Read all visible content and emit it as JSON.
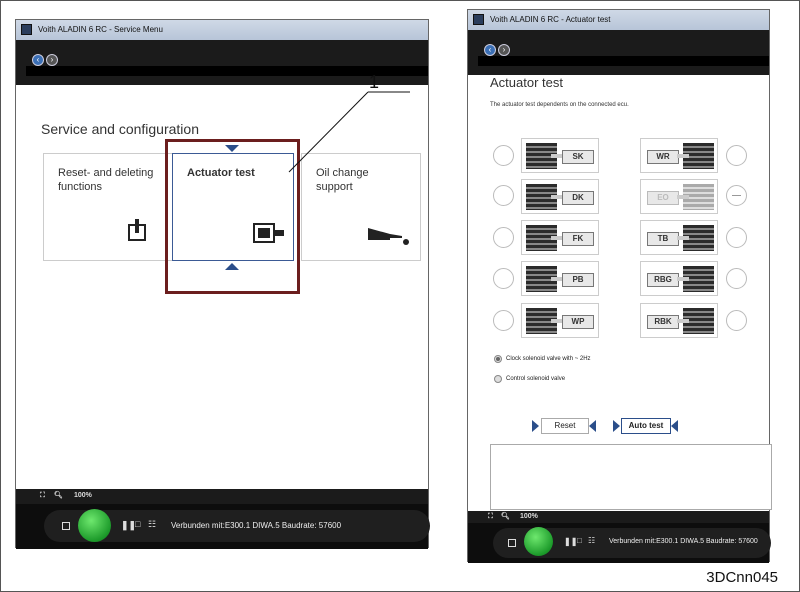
{
  "left_window": {
    "title": "Voith ALADIN 6 RC - Service Menu",
    "heading": "Service and configuration",
    "tiles": [
      {
        "label": "Reset- and deleting functions",
        "icon": "power-reset-icon"
      },
      {
        "label": "Actuator test",
        "icon": "actuator-valve-icon"
      },
      {
        "label": "Oil change support",
        "icon": "oil-can-icon"
      }
    ],
    "zoom": "100%",
    "connection": "Verbunden mit:E300.1  DIWA.5 Baudrate: 57600"
  },
  "callout_number": "1",
  "right_window": {
    "title": "Voith ALADIN 6 RC - Actuator test",
    "heading": "Actuator test",
    "subtitle": "The actuator test dependents on the connected ecu.",
    "valves_left": [
      "SK",
      "DK",
      "FK",
      "PB",
      "WP"
    ],
    "valves_right": [
      "WR",
      "EO",
      "TB",
      "RBG",
      "RBK"
    ],
    "disabled_valve": "EO",
    "radio_options": [
      {
        "label": "Clock solenoid valve with ~ 2Hz",
        "selected": true
      },
      {
        "label": "Control solenoid valve",
        "selected": false
      }
    ],
    "reset_label": "Reset",
    "auto_test_label": "Auto test",
    "zoom": "100%",
    "connection": "Verbunden mit:E300.1  DIWA.5 Baudrate: 57600"
  },
  "document_id": "3DCnn045",
  "colors": {
    "annotation_border": "#6b1e1e",
    "status_ok": "#1c9a2a",
    "nav_blue": "#3b6fb5"
  }
}
